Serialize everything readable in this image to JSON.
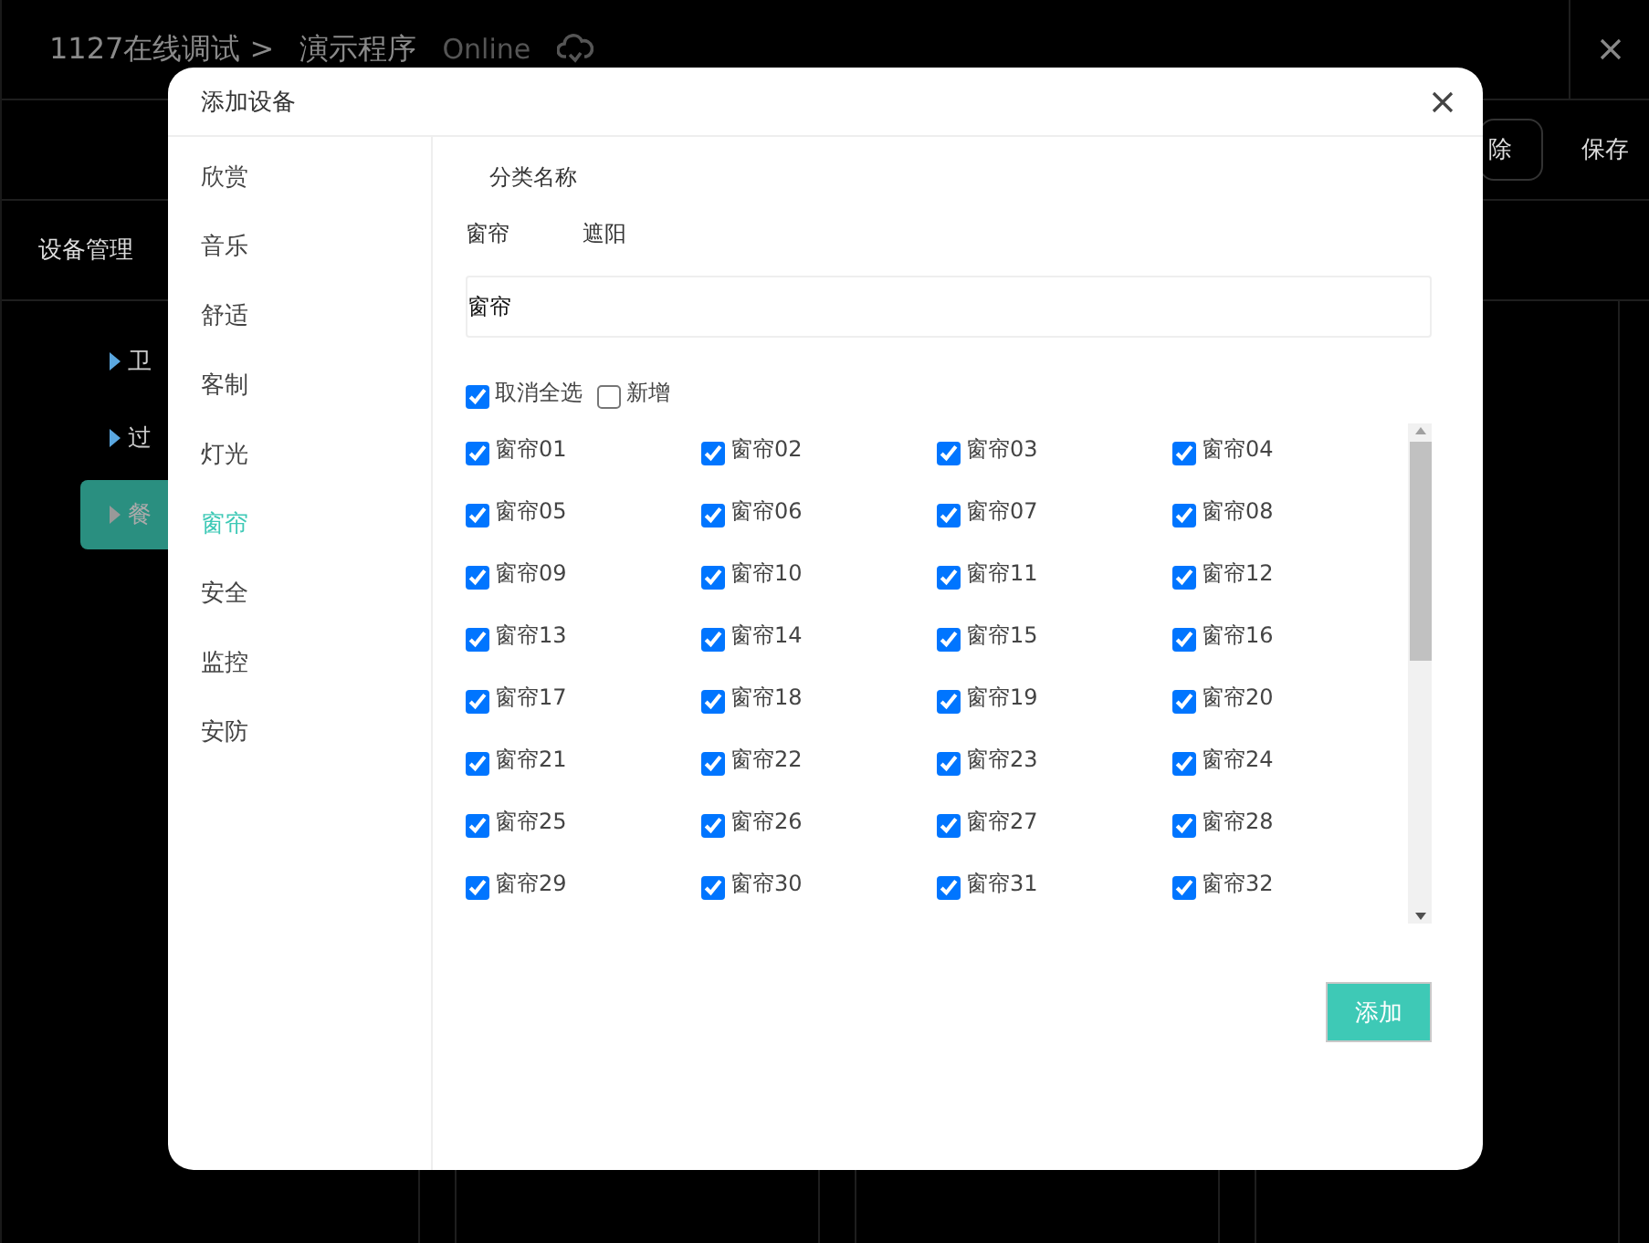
{
  "app": {
    "breadcrumb": "1127在线调试 >",
    "program": "演示程序",
    "status": "Online",
    "toolbar_buttons": [
      "除",
      "保存"
    ],
    "section_title": "设备管理",
    "tree": [
      {
        "label": "卫",
        "selected": false
      },
      {
        "label": "过",
        "selected": false
      },
      {
        "label": "餐",
        "selected": true
      }
    ]
  },
  "dialog": {
    "title": "添加设备",
    "categories": [
      {
        "label": "欣赏",
        "selected": false
      },
      {
        "label": "音乐",
        "selected": false
      },
      {
        "label": "舒适",
        "selected": false
      },
      {
        "label": "客制",
        "selected": false
      },
      {
        "label": "灯光",
        "selected": false
      },
      {
        "label": "窗帘",
        "selected": true
      },
      {
        "label": "安全",
        "selected": false
      },
      {
        "label": "监控",
        "selected": false
      },
      {
        "label": "安防",
        "selected": false
      }
    ],
    "category_name_label": "分类名称",
    "subcategories": [
      "窗帘",
      "遮阳"
    ],
    "name_value": "窗帘",
    "toggles": [
      {
        "label": "取消全选",
        "checked": true
      },
      {
        "label": "新增",
        "checked": false
      }
    ],
    "devices": [
      {
        "label": "窗帘01",
        "checked": true
      },
      {
        "label": "窗帘02",
        "checked": true
      },
      {
        "label": "窗帘03",
        "checked": true
      },
      {
        "label": "窗帘04",
        "checked": true
      },
      {
        "label": "窗帘05",
        "checked": true
      },
      {
        "label": "窗帘06",
        "checked": true
      },
      {
        "label": "窗帘07",
        "checked": true
      },
      {
        "label": "窗帘08",
        "checked": true
      },
      {
        "label": "窗帘09",
        "checked": true
      },
      {
        "label": "窗帘10",
        "checked": true
      },
      {
        "label": "窗帘11",
        "checked": true
      },
      {
        "label": "窗帘12",
        "checked": true
      },
      {
        "label": "窗帘13",
        "checked": true
      },
      {
        "label": "窗帘14",
        "checked": true
      },
      {
        "label": "窗帘15",
        "checked": true
      },
      {
        "label": "窗帘16",
        "checked": true
      },
      {
        "label": "窗帘17",
        "checked": true
      },
      {
        "label": "窗帘18",
        "checked": true
      },
      {
        "label": "窗帘19",
        "checked": true
      },
      {
        "label": "窗帘20",
        "checked": true
      },
      {
        "label": "窗帘21",
        "checked": true
      },
      {
        "label": "窗帘22",
        "checked": true
      },
      {
        "label": "窗帘23",
        "checked": true
      },
      {
        "label": "窗帘24",
        "checked": true
      },
      {
        "label": "窗帘25",
        "checked": true
      },
      {
        "label": "窗帘26",
        "checked": true
      },
      {
        "label": "窗帘27",
        "checked": true
      },
      {
        "label": "窗帘28",
        "checked": true
      },
      {
        "label": "窗帘29",
        "checked": true
      },
      {
        "label": "窗帘30",
        "checked": true
      },
      {
        "label": "窗帘31",
        "checked": true
      },
      {
        "label": "窗帘32",
        "checked": true
      }
    ],
    "submit": "添加"
  }
}
